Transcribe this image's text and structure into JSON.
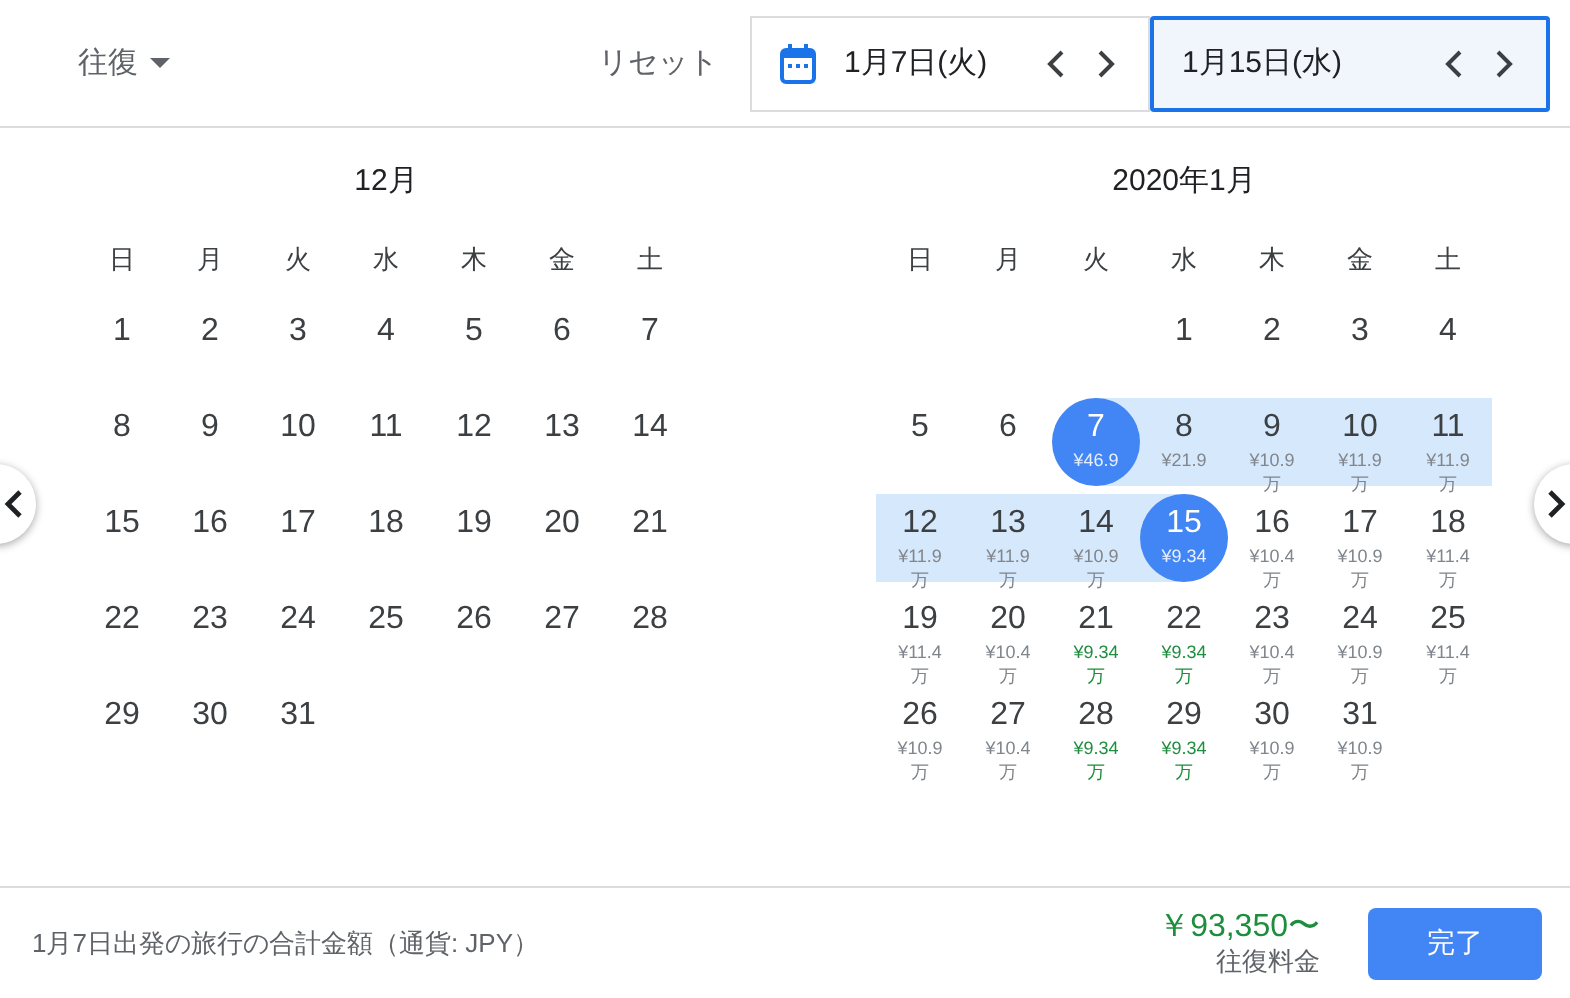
{
  "trip_type": {
    "label": "往復"
  },
  "reset": "リセット",
  "date_fields": [
    {
      "value": "1月7日(火)",
      "selected": false,
      "calendar_icon": true
    },
    {
      "value": "1月15日(水)",
      "selected": true,
      "calendar_icon": false
    }
  ],
  "months": [
    {
      "title": "12月",
      "weekdays": [
        "日",
        "月",
        "火",
        "水",
        "木",
        "金",
        "土"
      ],
      "days": [
        {
          "day": "1"
        },
        {
          "day": "2"
        },
        {
          "day": "3"
        },
        {
          "day": "4"
        },
        {
          "day": "5"
        },
        {
          "day": "6"
        },
        {
          "day": "7"
        },
        {
          "day": "8"
        },
        {
          "day": "9"
        },
        {
          "day": "10"
        },
        {
          "day": "11"
        },
        {
          "day": "12"
        },
        {
          "day": "13"
        },
        {
          "day": "14"
        },
        {
          "day": "15"
        },
        {
          "day": "16"
        },
        {
          "day": "17"
        },
        {
          "day": "18"
        },
        {
          "day": "19"
        },
        {
          "day": "20"
        },
        {
          "day": "21"
        },
        {
          "day": "22"
        },
        {
          "day": "23"
        },
        {
          "day": "24"
        },
        {
          "day": "25"
        },
        {
          "day": "26"
        },
        {
          "day": "27"
        },
        {
          "day": "28"
        },
        {
          "day": "29"
        },
        {
          "day": "30"
        },
        {
          "day": "31"
        }
      ]
    },
    {
      "title": "2020年1月",
      "weekdays": [
        "日",
        "月",
        "火",
        "水",
        "木",
        "金",
        "土"
      ],
      "days": [
        {
          "blank": true
        },
        {
          "blank": true
        },
        {
          "blank": true
        },
        {
          "day": "1"
        },
        {
          "day": "2"
        },
        {
          "day": "3"
        },
        {
          "day": "4"
        },
        {
          "day": "5"
        },
        {
          "day": "6"
        },
        {
          "day": "7",
          "price": "¥46.9",
          "cheap": false,
          "selected": true,
          "in_range": true
        },
        {
          "day": "8",
          "price": "¥21.9",
          "cheap": false,
          "selected": false,
          "in_range": true
        },
        {
          "day": "9",
          "price": "¥10.9万",
          "cheap": false,
          "selected": false,
          "in_range": true
        },
        {
          "day": "10",
          "price": "¥11.9万",
          "cheap": false,
          "selected": false,
          "in_range": true
        },
        {
          "day": "11",
          "price": "¥11.9万",
          "cheap": false,
          "selected": false,
          "in_range": true
        },
        {
          "day": "12",
          "price": "¥11.9万",
          "cheap": false,
          "selected": false,
          "in_range": true
        },
        {
          "day": "13",
          "price": "¥11.9万",
          "cheap": false,
          "selected": false,
          "in_range": true
        },
        {
          "day": "14",
          "price": "¥10.9万",
          "cheap": false,
          "selected": false,
          "in_range": true
        },
        {
          "day": "15",
          "price": "¥9.34",
          "cheap": false,
          "selected": true,
          "in_range": true
        },
        {
          "day": "16",
          "price": "¥10.4万",
          "cheap": false,
          "selected": false,
          "in_range": false
        },
        {
          "day": "17",
          "price": "¥10.9万",
          "cheap": false,
          "selected": false,
          "in_range": false
        },
        {
          "day": "18",
          "price": "¥11.4万",
          "cheap": false,
          "selected": false,
          "in_range": false
        },
        {
          "day": "19",
          "price": "¥11.4万",
          "cheap": false,
          "selected": false,
          "in_range": false
        },
        {
          "day": "20",
          "price": "¥10.4万",
          "cheap": false,
          "selected": false,
          "in_range": false
        },
        {
          "day": "21",
          "price": "¥9.34万",
          "cheap": true,
          "selected": false,
          "in_range": false
        },
        {
          "day": "22",
          "price": "¥9.34万",
          "cheap": true,
          "selected": false,
          "in_range": false
        },
        {
          "day": "23",
          "price": "¥10.4万",
          "cheap": false,
          "selected": false,
          "in_range": false
        },
        {
          "day": "24",
          "price": "¥10.9万",
          "cheap": false,
          "selected": false,
          "in_range": false
        },
        {
          "day": "25",
          "price": "¥11.4万",
          "cheap": false,
          "selected": false,
          "in_range": false
        },
        {
          "day": "26",
          "price": "¥10.9万",
          "cheap": false,
          "selected": false,
          "in_range": false
        },
        {
          "day": "27",
          "price": "¥10.4万",
          "cheap": false,
          "selected": false,
          "in_range": false
        },
        {
          "day": "28",
          "price": "¥9.34万",
          "cheap": true,
          "selected": false,
          "in_range": false
        },
        {
          "day": "29",
          "price": "¥9.34万",
          "cheap": true,
          "selected": false,
          "in_range": false
        },
        {
          "day": "30",
          "price": "¥10.9万",
          "cheap": false,
          "selected": false,
          "in_range": false
        },
        {
          "day": "31",
          "price": "¥10.9万",
          "cheap": false,
          "selected": false,
          "in_range": false
        }
      ]
    }
  ],
  "footer": {
    "note": "1月7日出発の旅行の合計金額（通貨: JPY）",
    "price": "￥93,350〜",
    "price_label": "往復料金",
    "done_button": "完了"
  }
}
